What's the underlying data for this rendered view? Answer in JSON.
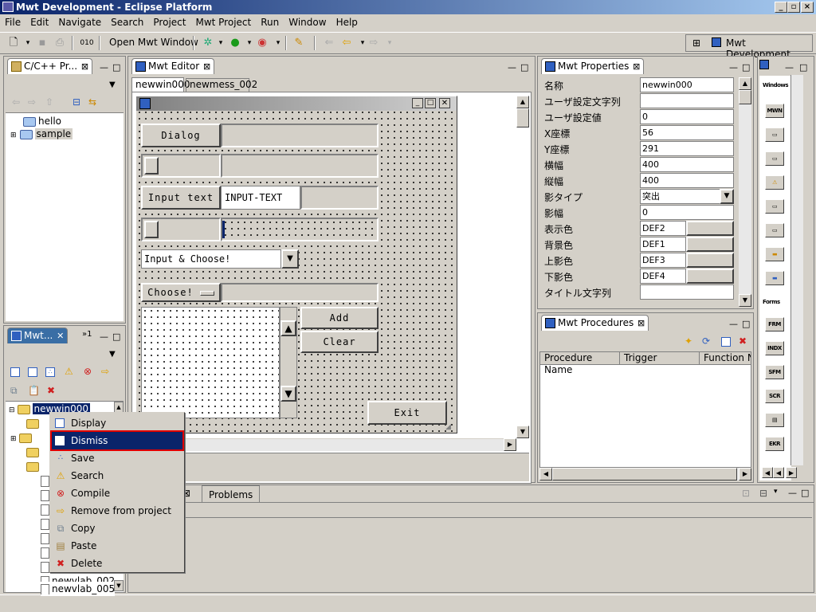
{
  "window": {
    "title": "Mwt Development - Eclipse Platform"
  },
  "menu": [
    "File",
    "Edit",
    "Navigate",
    "Search",
    "Project",
    "Mwt Project",
    "Run",
    "Window",
    "Help"
  ],
  "toolbar": {
    "open_window_label": "Open Mwt Window",
    "perspective_label": "Mwt Development"
  },
  "cpp_view": {
    "tab": "C/C++ Pr...",
    "tree": [
      {
        "label": "hello"
      },
      {
        "label": "sample"
      }
    ]
  },
  "mwt_view": {
    "tab": "Mwt...",
    "tab_count": "»1",
    "tree": [
      {
        "label": "newwin000"
      },
      {
        "label": "newvlab_002"
      },
      {
        "label": "newvlab_005"
      }
    ]
  },
  "editor": {
    "tab": "Mwt Editor",
    "subtabs": [
      "newwin000",
      "newmess_002"
    ],
    "canvas": {
      "dialog_btn": "Dialog",
      "input_text_btn": "Input text",
      "input_text_value": "INPUT-TEXT",
      "combo_value": "Input & Choose!",
      "choose_btn": "Choose!",
      "add_btn": "Add",
      "clear_btn": "Clear",
      "exit_btn": "Exit"
    }
  },
  "properties": {
    "tab": "Mwt Properties",
    "rows": [
      {
        "label": "名称",
        "value": "newwin000"
      },
      {
        "label": "ユーザ設定文字列",
        "value": ""
      },
      {
        "label": "ユーザ設定値",
        "value": "0"
      },
      {
        "label": "X座標",
        "value": "56"
      },
      {
        "label": "Y座標",
        "value": "291"
      },
      {
        "label": "横幅",
        "value": "400"
      },
      {
        "label": "縦幅",
        "value": "400"
      },
      {
        "label": "影タイプ",
        "value": "突出"
      },
      {
        "label": "影幅",
        "value": "0"
      },
      {
        "label": "表示色",
        "value": "DEF2"
      },
      {
        "label": "背景色",
        "value": "DEF1"
      },
      {
        "label": "上影色",
        "value": "DEF3"
      },
      {
        "label": "下影色",
        "value": "DEF4"
      },
      {
        "label": "タイトル文字列",
        "value": ""
      }
    ]
  },
  "procedures": {
    "tab": "Mwt Procedures",
    "columns": [
      "Procedure Name",
      "Trigger",
      "Function Na"
    ]
  },
  "bottom": {
    "problems_tab": "Problems"
  },
  "palette": {
    "sections": [
      "Windows",
      "Forms"
    ],
    "items": [
      "MWN",
      "",
      "",
      "⚠",
      "",
      "",
      "",
      "",
      "FRM",
      "INDX",
      "SFM",
      "SCR",
      "",
      "EKR"
    ]
  },
  "context_menu": {
    "items": [
      {
        "label": "Display",
        "icon": "window-icon"
      },
      {
        "label": "Dismiss",
        "icon": "window-icon",
        "highlighted": true
      },
      {
        "label": "Save",
        "icon": "save-icon"
      },
      {
        "label": "Search",
        "icon": "warning-icon"
      },
      {
        "label": "Compile",
        "icon": "error-icon"
      },
      {
        "label": "Remove from project",
        "icon": "arrow-right-icon"
      },
      {
        "label": "Copy",
        "icon": "copy-icon"
      },
      {
        "label": "Paste",
        "icon": "paste-icon"
      },
      {
        "label": "Delete",
        "icon": "delete-icon"
      }
    ]
  },
  "colors": {
    "highlight": "#0a246a",
    "selection_outline": "#e00000",
    "title_start": "#0a246a",
    "title_end": "#a6caf0"
  }
}
